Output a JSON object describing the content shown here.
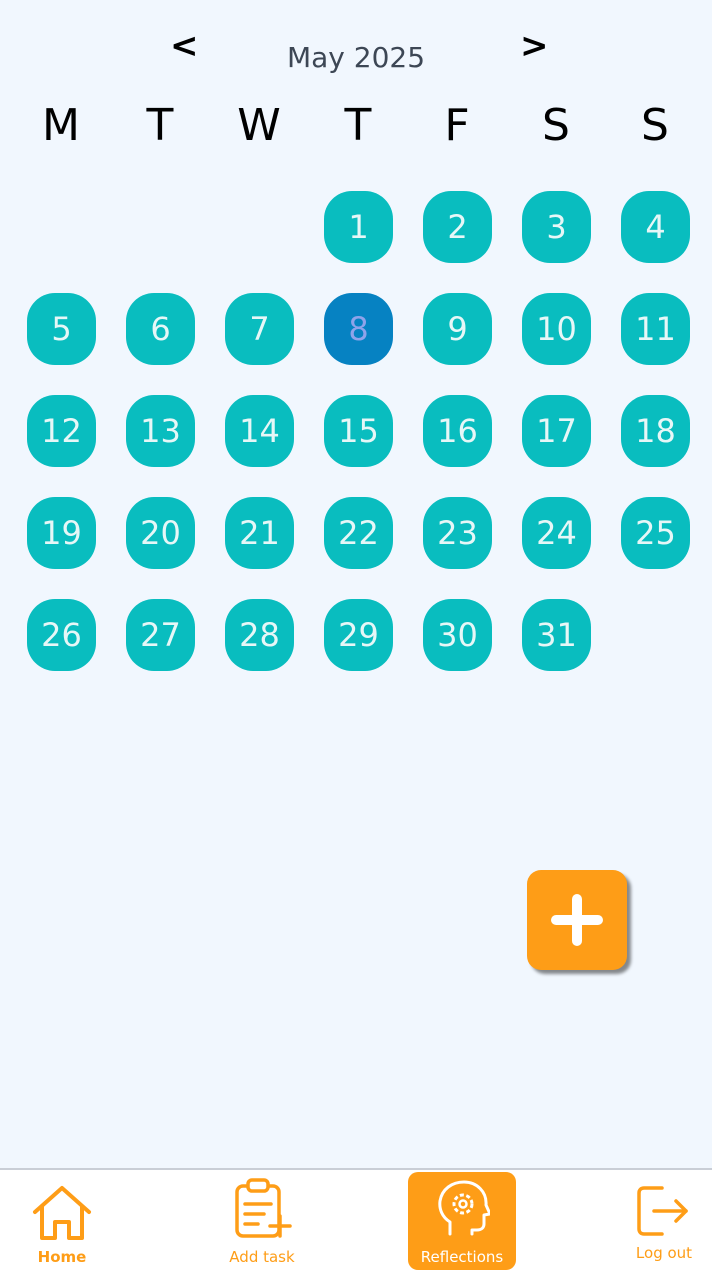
{
  "header": {
    "prev_label": "<",
    "next_label": ">",
    "month_label": "May 2025"
  },
  "weekdays": [
    "M",
    "T",
    "W",
    "T",
    "F",
    "S",
    "S"
  ],
  "calendar": {
    "days": [
      "1",
      "2",
      "3",
      "4",
      "5",
      "6",
      "7",
      "8",
      "9",
      "10",
      "11",
      "12",
      "13",
      "14",
      "15",
      "16",
      "17",
      "18",
      "19",
      "20",
      "21",
      "22",
      "23",
      "24",
      "25",
      "26",
      "27",
      "28",
      "29",
      "30",
      "31"
    ],
    "selected_day": "8",
    "day_color": "#09bdbf",
    "selected_color": "#0682c2"
  },
  "fab": {
    "icon": "plus-icon"
  },
  "bottom_nav": {
    "home_label": "Home",
    "add_task_label": "Add task",
    "reflections_label": "Reflections",
    "logout_label": "Log out",
    "accent_color": "#fe9d17"
  }
}
